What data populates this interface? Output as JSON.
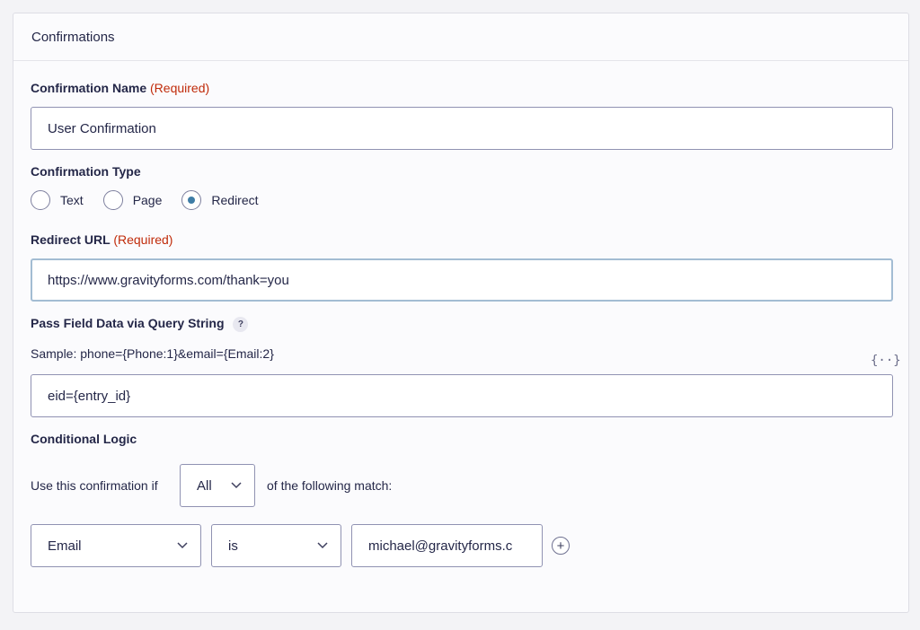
{
  "panel": {
    "title": "Confirmations"
  },
  "confirmation_name": {
    "label": "Confirmation Name",
    "required": "(Required)",
    "value": "User Confirmation"
  },
  "confirmation_type": {
    "label": "Confirmation Type",
    "options": [
      "Text",
      "Page",
      "Redirect"
    ],
    "selected": "Redirect"
  },
  "redirect_url": {
    "label": "Redirect URL",
    "required": "(Required)",
    "value": "https://www.gravityforms.com/thank=you"
  },
  "query_string": {
    "label": "Pass Field Data via Query String",
    "help": "?",
    "sample": "Sample: phone={Phone:1}&email={Email:2}",
    "merge_tag": "{··}",
    "value": "eid={entry_id}"
  },
  "conditional_logic": {
    "label": "Conditional Logic",
    "prefix": "Use this confirmation if",
    "match_value": "All",
    "suffix": "of the following match:",
    "rule": {
      "field": "Email",
      "operator": "is",
      "value": "michael@gravityforms.c"
    },
    "add": "+"
  },
  "colors": {
    "required": "#c02b0a",
    "radio_checked": "#3e7da6",
    "focus_border": "#a3bcd3"
  }
}
